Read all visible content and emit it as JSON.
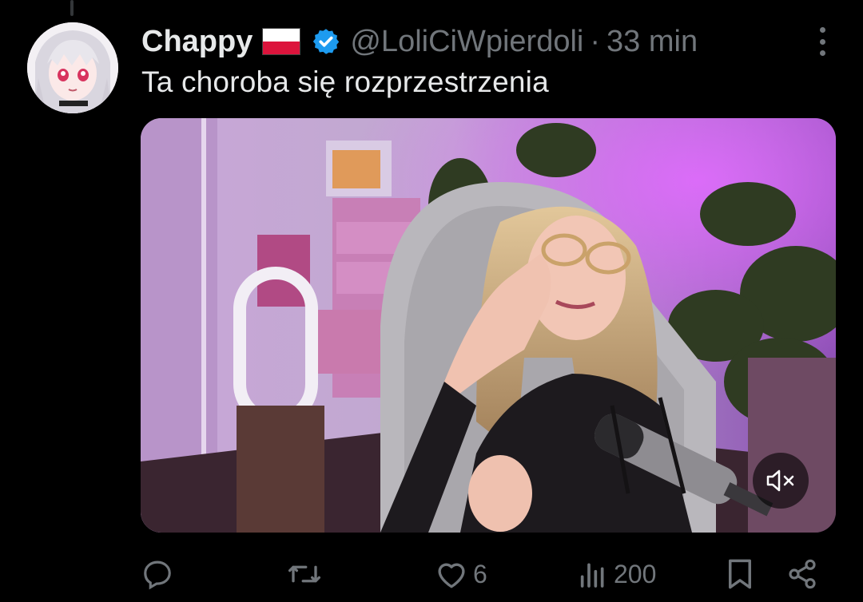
{
  "tweet": {
    "display_name": "Chappy",
    "flag_icon": "poland-flag-icon",
    "verified_icon": "verified-badge-icon",
    "handle": "@LoliCiWpierdoli",
    "separator": "·",
    "time": "33 min",
    "text": "Ta choroba się rozprzestrzenia"
  },
  "media": {
    "type": "video",
    "mute_icon": "speaker-muted-icon"
  },
  "actions": {
    "reply": {
      "icon": "reply-icon",
      "count": ""
    },
    "retweet": {
      "icon": "retweet-icon",
      "count": ""
    },
    "like": {
      "icon": "heart-icon",
      "count": "6"
    },
    "views": {
      "icon": "views-icon",
      "count": "200"
    },
    "bookmark": {
      "icon": "bookmark-icon"
    },
    "share": {
      "icon": "share-icon"
    }
  },
  "colors": {
    "background": "#000000",
    "text": "#e7e9ea",
    "secondary": "#71767b",
    "verified": "#1d9bf0"
  }
}
